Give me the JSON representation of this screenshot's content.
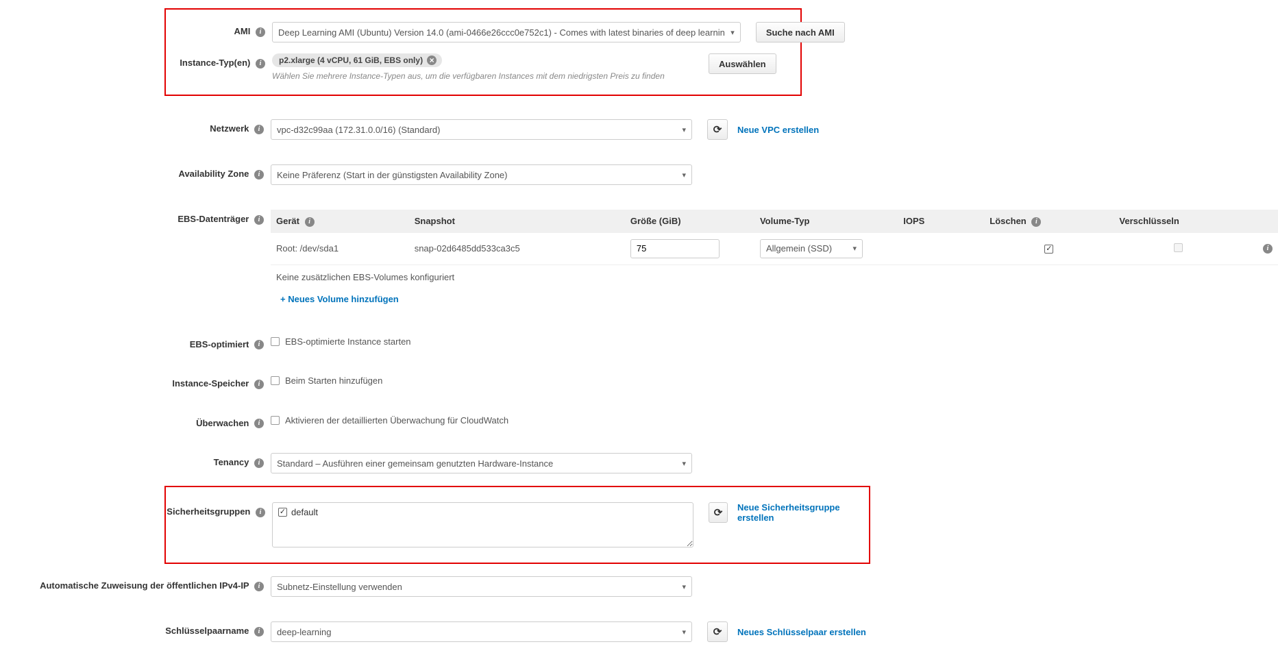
{
  "highlight1": {
    "ami_label": "AMI",
    "ami_value": "Deep Learning AMI (Ubuntu) Version 14.0 (ami-0466e26ccc0e752c1) - Comes with latest binaries of deep learnin",
    "ami_search_btn": "Suche nach AMI",
    "instance_type_label": "Instance-Typ(en)",
    "instance_type_pill": "p2.xlarge (4 vCPU, 61 GiB, EBS only)",
    "instance_type_select_btn": "Auswählen",
    "instance_type_help": "Wählen Sie mehrere Instance-Typen aus, um die verfügbaren Instances mit dem niedrigsten Preis zu finden"
  },
  "network": {
    "label": "Netzwerk",
    "value": "vpc-d32c99aa (172.31.0.0/16) (Standard)",
    "create_link": "Neue VPC erstellen"
  },
  "az": {
    "label": "Availability Zone",
    "value": "Keine Präferenz (Start in der günstigsten Availability Zone)"
  },
  "ebs": {
    "label": "EBS-Datenträger",
    "headers": {
      "device": "Gerät",
      "snapshot": "Snapshot",
      "size": "Größe (GiB)",
      "voltype": "Volume-Typ",
      "iops": "IOPS",
      "delete": "Löschen",
      "encrypt": "Verschlüsseln"
    },
    "row": {
      "device": "Root: /dev/sda1",
      "snapshot": "snap-02d6485dd533ca3c5",
      "size": "75",
      "voltype": "Allgemein (SSD)"
    },
    "no_extra": "Keine zusätzlichen EBS-Volumes konfiguriert",
    "add_volume": "+ Neues Volume hinzufügen"
  },
  "ebs_opt": {
    "label": "EBS-optimiert",
    "cb_label": "EBS-optimierte Instance starten"
  },
  "inst_store": {
    "label": "Instance-Speicher",
    "cb_label": "Beim Starten hinzufügen"
  },
  "monitor": {
    "label": "Überwachen",
    "cb_label": "Aktivieren der detaillierten Überwachung für CloudWatch"
  },
  "tenancy": {
    "label": "Tenancy",
    "value": "Standard – Ausführen einer gemeinsam genutzten Hardware-Instance"
  },
  "sg": {
    "label": "Sicherheitsgruppen",
    "item": "default",
    "create_link": "Neue Sicherheitsgruppe erstellen"
  },
  "ipv4": {
    "label": "Automatische Zuweisung der öffentlichen IPv4-IP",
    "value": "Subnetz-Einstellung verwenden"
  },
  "keypair": {
    "label": "Schlüsselpaarname",
    "value": "deep-learning",
    "create_link": "Neues Schlüsselpaar erstellen"
  }
}
